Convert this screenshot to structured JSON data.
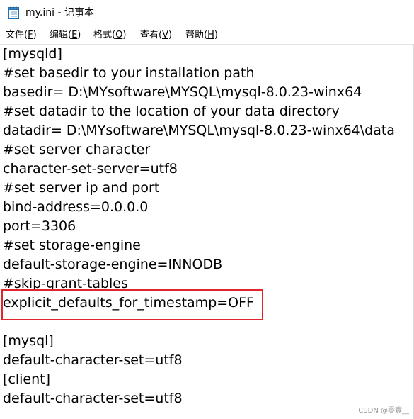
{
  "window": {
    "title": "my.ini - 记事本"
  },
  "icons": {
    "app_icon": "notepad-icon"
  },
  "menu": {
    "items": [
      {
        "label": "文件(",
        "accel": "F",
        "suffix": ")"
      },
      {
        "label": "编辑(",
        "accel": "E",
        "suffix": ")"
      },
      {
        "label": "格式(",
        "accel": "O",
        "suffix": ")"
      },
      {
        "label": "查看(",
        "accel": "V",
        "suffix": ")"
      },
      {
        "label": "帮助(",
        "accel": "H",
        "suffix": ")"
      }
    ]
  },
  "editor": {
    "lines": [
      "[mysqld]",
      "#set basedir to your installation path",
      "basedir= D:\\MYsoftware\\MYSQL\\mysql-8.0.23-winx64",
      "#set datadir to the location of your data directory",
      "datadir= D:\\MYsoftware\\MYSQL\\mysql-8.0.23-winx64\\data",
      "#set server character",
      "character-set-server=utf8",
      "#set server ip and port",
      "bind-address=0.0.0.0",
      "port=3306",
      "#set storage-engine",
      "default-storage-engine=INNODB",
      "#skip-grant-tables",
      "explicit_defaults_for_timestamp=OFF",
      "",
      "[mysql]",
      "default-character-set=utf8",
      "[client]",
      "default-character-set=utf8"
    ],
    "highlighted_line_index": 13
  },
  "colors": {
    "highlight_border": "#e0262c",
    "text": "#000000",
    "background": "#ffffff"
  },
  "watermark": {
    "text": "CSDN @零壹__"
  }
}
